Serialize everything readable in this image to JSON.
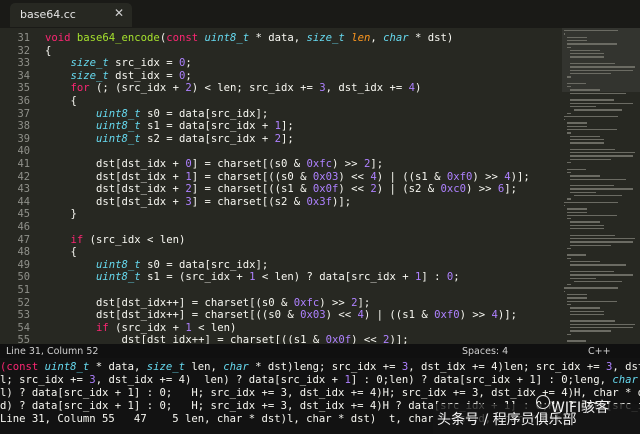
{
  "tab": {
    "title": "base64.cc",
    "close_glyph": "✕"
  },
  "gutter_numbers": [
    "31",
    "32",
    "33",
    "34",
    "35",
    "36",
    "37",
    "38",
    "39",
    "40",
    "41",
    "42",
    "43",
    "44",
    "45",
    "46",
    "47",
    "48",
    "49",
    "50",
    "51",
    "52",
    "53",
    "54",
    "55"
  ],
  "code_lines": [
    [
      {
        "c": "k",
        "t": "void "
      },
      {
        "c": "f",
        "t": "base64_encode"
      },
      {
        "c": "x",
        "t": "("
      },
      {
        "c": "k",
        "t": "const "
      },
      {
        "c": "t",
        "t": "uint8_t"
      },
      {
        "c": "x",
        "t": " * data, "
      },
      {
        "c": "t",
        "t": "size_t"
      },
      {
        "c": "p",
        "t": " len"
      },
      {
        "c": "x",
        "t": ", "
      },
      {
        "c": "t",
        "t": "char"
      },
      {
        "c": "x",
        "t": " * dst)"
      }
    ],
    [
      {
        "c": "x",
        "t": "{"
      }
    ],
    [
      {
        "c": "x",
        "t": "    "
      },
      {
        "c": "t",
        "t": "size_t"
      },
      {
        "c": "x",
        "t": " src_idx = "
      },
      {
        "c": "n",
        "t": "0"
      },
      {
        "c": "x",
        "t": ";"
      }
    ],
    [
      {
        "c": "x",
        "t": "    "
      },
      {
        "c": "t",
        "t": "size_t"
      },
      {
        "c": "x",
        "t": " dst_idx = "
      },
      {
        "c": "n",
        "t": "0"
      },
      {
        "c": "x",
        "t": ";"
      }
    ],
    [
      {
        "c": "x",
        "t": "    "
      },
      {
        "c": "k",
        "t": "for"
      },
      {
        "c": "x",
        "t": " (; (src_idx + "
      },
      {
        "c": "n",
        "t": "2"
      },
      {
        "c": "x",
        "t": ") < len; src_idx += "
      },
      {
        "c": "n",
        "t": "3"
      },
      {
        "c": "x",
        "t": ", dst_idx += "
      },
      {
        "c": "n",
        "t": "4"
      },
      {
        "c": "x",
        "t": ")"
      }
    ],
    [
      {
        "c": "x",
        "t": "    {"
      }
    ],
    [
      {
        "c": "x",
        "t": "        "
      },
      {
        "c": "t",
        "t": "uint8_t"
      },
      {
        "c": "x",
        "t": " s0 = data[src_idx];"
      }
    ],
    [
      {
        "c": "x",
        "t": "        "
      },
      {
        "c": "t",
        "t": "uint8_t"
      },
      {
        "c": "x",
        "t": " s1 = data[src_idx + "
      },
      {
        "c": "n",
        "t": "1"
      },
      {
        "c": "x",
        "t": "];"
      }
    ],
    [
      {
        "c": "x",
        "t": "        "
      },
      {
        "c": "t",
        "t": "uint8_t"
      },
      {
        "c": "x",
        "t": " s2 = data[src_idx + "
      },
      {
        "c": "n",
        "t": "2"
      },
      {
        "c": "x",
        "t": "];"
      }
    ],
    [
      {
        "c": "x",
        "t": ""
      }
    ],
    [
      {
        "c": "x",
        "t": "        dst[dst_idx + "
      },
      {
        "c": "n",
        "t": "0"
      },
      {
        "c": "x",
        "t": "] = charset[(s0 & "
      },
      {
        "c": "n",
        "t": "0xfc"
      },
      {
        "c": "x",
        "t": ") >> "
      },
      {
        "c": "n",
        "t": "2"
      },
      {
        "c": "x",
        "t": "];"
      }
    ],
    [
      {
        "c": "x",
        "t": "        dst[dst_idx + "
      },
      {
        "c": "n",
        "t": "1"
      },
      {
        "c": "x",
        "t": "] = charset[((s0 & "
      },
      {
        "c": "n",
        "t": "0x03"
      },
      {
        "c": "x",
        "t": ") << "
      },
      {
        "c": "n",
        "t": "4"
      },
      {
        "c": "x",
        "t": ") | ((s1 & "
      },
      {
        "c": "n",
        "t": "0xf0"
      },
      {
        "c": "x",
        "t": ") >> "
      },
      {
        "c": "n",
        "t": "4"
      },
      {
        "c": "x",
        "t": ")];"
      }
    ],
    [
      {
        "c": "x",
        "t": "        dst[dst_idx + "
      },
      {
        "c": "n",
        "t": "2"
      },
      {
        "c": "x",
        "t": "] = charset[((s1 & "
      },
      {
        "c": "n",
        "t": "0x0f"
      },
      {
        "c": "x",
        "t": ") << "
      },
      {
        "c": "n",
        "t": "2"
      },
      {
        "c": "x",
        "t": ") | (s2 & "
      },
      {
        "c": "n",
        "t": "0xc0"
      },
      {
        "c": "x",
        "t": ") >> "
      },
      {
        "c": "n",
        "t": "6"
      },
      {
        "c": "x",
        "t": "];"
      }
    ],
    [
      {
        "c": "x",
        "t": "        dst[dst_idx + "
      },
      {
        "c": "n",
        "t": "3"
      },
      {
        "c": "x",
        "t": "] = charset[(s2 & "
      },
      {
        "c": "n",
        "t": "0x3f"
      },
      {
        "c": "x",
        "t": ")];"
      }
    ],
    [
      {
        "c": "x",
        "t": "    }"
      }
    ],
    [
      {
        "c": "x",
        "t": ""
      }
    ],
    [
      {
        "c": "x",
        "t": "    "
      },
      {
        "c": "k",
        "t": "if"
      },
      {
        "c": "x",
        "t": " (src_idx < len)"
      }
    ],
    [
      {
        "c": "x",
        "t": "    {"
      }
    ],
    [
      {
        "c": "x",
        "t": "        "
      },
      {
        "c": "t",
        "t": "uint8_t"
      },
      {
        "c": "x",
        "t": " s0 = data[src_idx];"
      }
    ],
    [
      {
        "c": "x",
        "t": "        "
      },
      {
        "c": "t",
        "t": "uint8_t"
      },
      {
        "c": "x",
        "t": " s1 = (src_idx + "
      },
      {
        "c": "n",
        "t": "1"
      },
      {
        "c": "x",
        "t": " < len) ? data[src_idx + "
      },
      {
        "c": "n",
        "t": "1"
      },
      {
        "c": "x",
        "t": "] : "
      },
      {
        "c": "n",
        "t": "0"
      },
      {
        "c": "x",
        "t": ";"
      }
    ],
    [
      {
        "c": "x",
        "t": ""
      }
    ],
    [
      {
        "c": "x",
        "t": "        dst[dst_idx++] = charset[(s0 & "
      },
      {
        "c": "n",
        "t": "0xfc"
      },
      {
        "c": "x",
        "t": ") >> "
      },
      {
        "c": "n",
        "t": "2"
      },
      {
        "c": "x",
        "t": "];"
      }
    ],
    [
      {
        "c": "x",
        "t": "        dst[dst_idx++] = charset[((s0 & "
      },
      {
        "c": "n",
        "t": "0x03"
      },
      {
        "c": "x",
        "t": ") << "
      },
      {
        "c": "n",
        "t": "4"
      },
      {
        "c": "x",
        "t": ") | ((s1 & "
      },
      {
        "c": "n",
        "t": "0xf0"
      },
      {
        "c": "x",
        "t": ") >> "
      },
      {
        "c": "n",
        "t": "4"
      },
      {
        "c": "x",
        "t": ")];"
      }
    ],
    [
      {
        "c": "x",
        "t": "        "
      },
      {
        "c": "k",
        "t": "if"
      },
      {
        "c": "x",
        "t": " (src_idx + "
      },
      {
        "c": "n",
        "t": "1"
      },
      {
        "c": "x",
        "t": " < len)"
      }
    ],
    [
      {
        "c": "x",
        "t": "            dst[dst_idx++] = charset[((s1 & "
      },
      {
        "c": "n",
        "t": "0x0f"
      },
      {
        "c": "x",
        "t": ") << "
      },
      {
        "c": "n",
        "t": "2"
      },
      {
        "c": "x",
        "t": ")];"
      }
    ],
    [
      {
        "c": "x",
        "t": "    }"
      }
    ]
  ],
  "status_bar": {
    "position": "Line 31, Column 52",
    "spaces": "Spaces: 4",
    "syntax": "C++"
  },
  "autocomplete_rows": [
    [
      {
        "c": "k",
        "t": "(const "
      },
      {
        "c": "t",
        "t": "uint8_t"
      },
      {
        "c": "x",
        "t": " * data, "
      },
      {
        "c": "t",
        "t": "size_t"
      },
      {
        "c": "x",
        "t": " len, "
      },
      {
        "c": "t",
        "t": "char"
      },
      {
        "c": "x",
        "t": " * dst)leng; src_idx += "
      },
      {
        "c": "n",
        "t": "3"
      },
      {
        "c": "x",
        "t": ", dst_idx += 4)len; src_idx += "
      },
      {
        "c": "n",
        "t": "3"
      },
      {
        "c": "x",
        "t": ", dst_idx += 4)len"
      }
    ],
    [
      {
        "c": "x",
        "t": "l; src_idx += "
      },
      {
        "c": "n",
        "t": "3"
      },
      {
        "c": "x",
        "t": ", dst_idx += 4)  len) ? data[src_idx + "
      },
      {
        "c": "n",
        "t": "1"
      },
      {
        "c": "x",
        "t": "] : 0;len) ? data[src_idx + 1] : 0;leng, "
      },
      {
        "c": "t",
        "t": "char"
      },
      {
        "c": "x",
        "t": " * dst)"
      }
    ],
    [
      {
        "c": "x",
        "t": "l) ? data[src_idx + 1] : 0;   H; src_idx += 3, dst_idx += 4)H; src_idx += 3, dst_idx += 4)H, char * dst)   54"
      }
    ],
    [
      {
        "c": "x",
        "t": "d) ? data[src_idx + 1] : 0;   H; src_idx += 3, dst_idx += 4)H ? data[src_idx + 1] : 0;H) ? data[src_idx + 1] : 0;"
      }
    ],
    [
      {
        "c": "x",
        "t": "Line 31, Column 55   47    5 len, char * dst)l, char * dst)  t, char * dst)d, char * dst)"
      }
    ]
  ],
  "watermark": {
    "line1": "头条号 / 程序员俱乐部",
    "line2": "WIFI骇客"
  },
  "colors": {
    "background": "#272822",
    "keyword": "#f92672",
    "type": "#66d9ef",
    "function": "#a6e22e",
    "number": "#ae81ff",
    "param": "#fd971f"
  }
}
